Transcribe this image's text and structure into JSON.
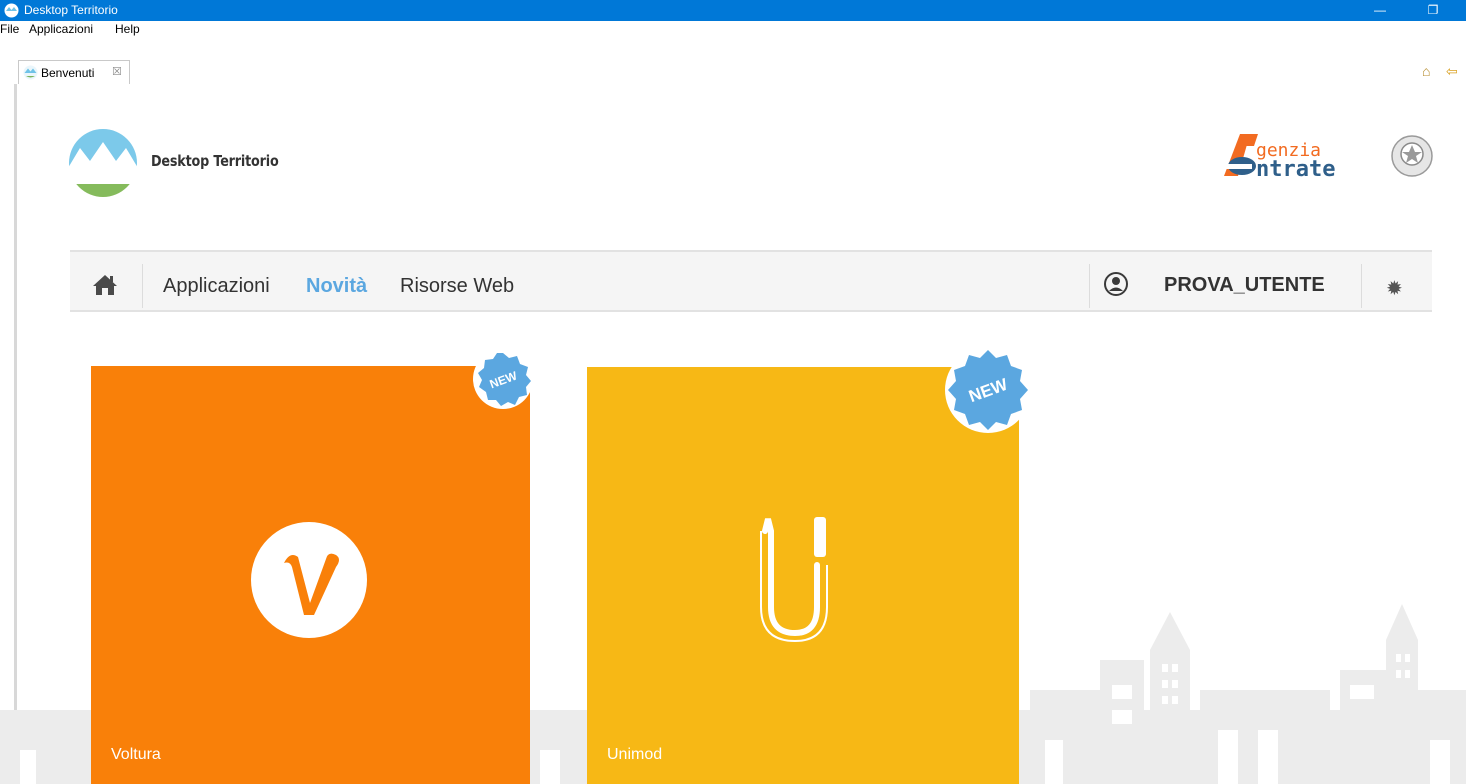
{
  "window": {
    "title": "Desktop Territorio",
    "minimize_glyph": "—",
    "restore_glyph": "❐"
  },
  "menu": [
    "File",
    "Applicazioni",
    "Help"
  ],
  "tab": {
    "label": "Benvenuti",
    "close_glyph": "☒"
  },
  "toolbar": {
    "home_glyph": "⌂",
    "back_glyph": "⇦"
  },
  "header": {
    "app_name": "Desktop Territorio",
    "agency_line1": "genzia",
    "agency_line2": "ntrate"
  },
  "nav": {
    "items": [
      "Applicazioni",
      "Novità",
      "Risorse Web"
    ],
    "active": "Novità",
    "user_name": "PROVA_UTENTE",
    "gear_glyph": "✹"
  },
  "tiles": [
    {
      "label": "Voltura",
      "badge": "NEW",
      "color": "#f98009"
    },
    {
      "label": "Unimod",
      "badge": "NEW",
      "color": "#f7b815"
    }
  ],
  "colors": {
    "titlebar": "#0078d7",
    "accent": "#5ba7e0",
    "badge": "#5ba7e0"
  }
}
